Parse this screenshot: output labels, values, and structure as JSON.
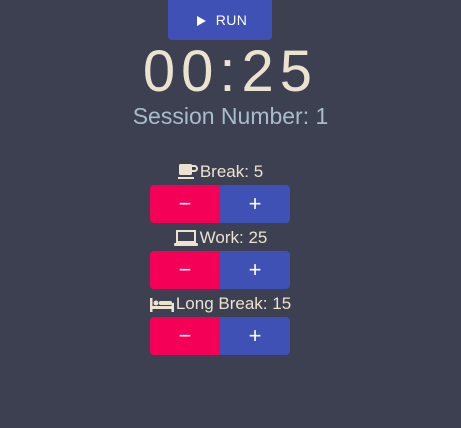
{
  "run_button": {
    "label": "RUN",
    "icon": "play-icon"
  },
  "timer": {
    "display": "00:25"
  },
  "session": {
    "text": "Session Number: 1"
  },
  "settings": [
    {
      "key": "break",
      "icon": "coffee-cup-icon",
      "label": "Break: 5",
      "decrement_label": "−",
      "increment_label": "+"
    },
    {
      "key": "work",
      "icon": "laptop-icon",
      "label": "Work: 25",
      "decrement_label": "−",
      "increment_label": "+"
    },
    {
      "key": "long_break",
      "icon": "bed-icon",
      "label": "Long Break: 15",
      "decrement_label": "−",
      "increment_label": "+"
    }
  ],
  "colors": {
    "background": "#3c4050",
    "primary": "#3f51b5",
    "secondary": "#f50057",
    "text": "#ece2d0",
    "session_text": "#a9bccb"
  }
}
